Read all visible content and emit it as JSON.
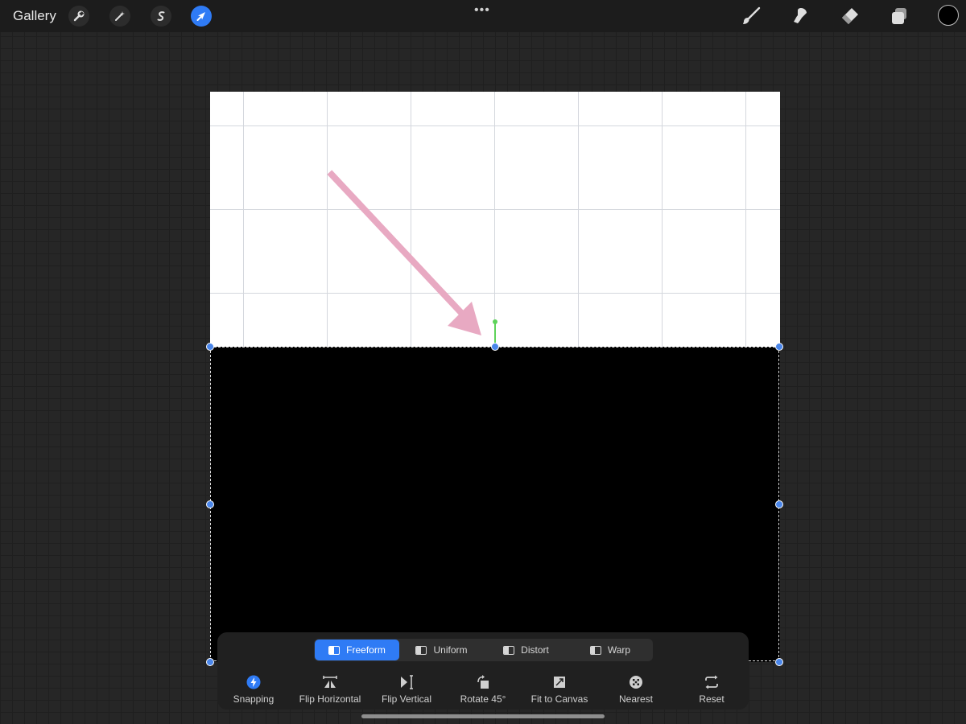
{
  "topbar": {
    "gallery_label": "Gallery",
    "left_tools": [
      "wrench-icon",
      "magic-wand-icon",
      "selection-s-icon",
      "transform-arrow-icon"
    ],
    "active_tool": "transform-arrow-icon",
    "right_tools": [
      "brush-icon",
      "smudge-icon",
      "eraser-icon",
      "layers-icon"
    ],
    "current_color": "#000000",
    "accent": "#2f7bf5"
  },
  "transform": {
    "modes": [
      {
        "label": "Freeform",
        "active": true
      },
      {
        "label": "Uniform",
        "active": false
      },
      {
        "label": "Distort",
        "active": false
      },
      {
        "label": "Warp",
        "active": false
      }
    ],
    "actions": [
      {
        "label": "Snapping",
        "icon": "lightning-icon"
      },
      {
        "label": "Flip Horizontal",
        "icon": "flip-horizontal-icon"
      },
      {
        "label": "Flip Vertical",
        "icon": "flip-vertical-icon"
      },
      {
        "label": "Rotate 45°",
        "icon": "rotate-icon"
      },
      {
        "label": "Fit to Canvas",
        "icon": "fit-canvas-icon"
      },
      {
        "label": "Nearest",
        "icon": "nearest-icon"
      },
      {
        "label": "Reset",
        "icon": "reset-icon"
      }
    ]
  },
  "colors": {
    "annotation_arrow": "#e8a9c2",
    "handle": "#4a86ea",
    "rotation_handle": "#5ed35a"
  }
}
